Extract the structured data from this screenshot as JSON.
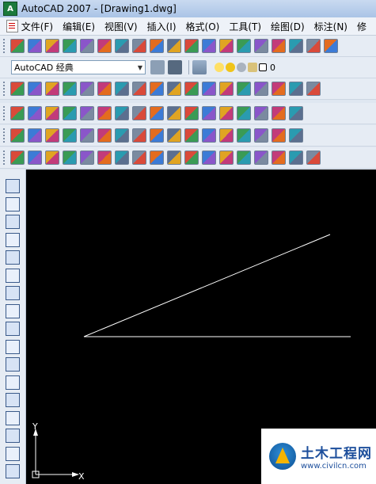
{
  "window": {
    "title": "AutoCAD 2007 - [Drawing1.dwg]",
    "app_icon_label": "A"
  },
  "menu": {
    "items": [
      "文件(F)",
      "编辑(E)",
      "视图(V)",
      "插入(I)",
      "格式(O)",
      "工具(T)",
      "绘图(D)",
      "标注(N)",
      "修"
    ]
  },
  "workspace": {
    "selected": "AutoCAD 经典"
  },
  "layer": {
    "current": "0"
  },
  "canvas": {
    "background": "#000000",
    "line_color": "#ffffff",
    "ucs_y_label": "Y",
    "ucs_x_label": "X"
  },
  "watermark": {
    "name": "土木工程网",
    "url": "www.civilcn.com"
  },
  "toolbars": {
    "row1_icons": [
      "new-icon",
      "open-icon",
      "save-icon",
      "print-icon",
      "preview-icon",
      "publish-icon",
      "plot-icon",
      "cut-icon",
      "copy-icon",
      "paste-icon",
      "match-prop-icon",
      "block-editor-icon",
      "undo-icon",
      "redo-icon",
      "pan-icon",
      "zoom-realtime-icon",
      "zoom-window-icon",
      "zoom-previous-icon",
      "properties-icon"
    ],
    "row3_icons": [
      "build-icon",
      "hidden-icon",
      "stair-icon",
      "hatch-icon",
      "grid-icon",
      "library-icon",
      "fixture-icon",
      "door-icon",
      "wall-icon",
      "circle-tool-icon",
      "spring-icon",
      "bolt-icon",
      "beam-icon",
      "tap-icon",
      "valve-icon",
      "tee-icon",
      "channel-icon",
      "pipe-icon"
    ],
    "row4_icons": [
      "table-icon",
      "find-icon",
      "erase-icon",
      "list-icon",
      "a2-icon",
      "search-icon",
      "component-icon",
      "cube-icon",
      "explode-icon",
      "join-icon",
      "mirror-icon",
      "curve-icon",
      "lock-icon",
      "swap-icon",
      "rotate-icon",
      "number-icon",
      "settings-icon"
    ],
    "row5_icons": [
      "text-icon",
      "angle-icon",
      "offset-icon",
      "snap-icon",
      "grip-icon",
      "align-icon",
      "distribute-icon",
      "stretch-icon",
      "measure-icon",
      "link-icon",
      "chain-icon",
      "scale-icon",
      "cross-icon",
      "trim-icon",
      "extend-icon",
      "fillet-icon",
      "chamfer-icon"
    ],
    "row6_icons": [
      "dim-linear-icon",
      "dim-weld-icon",
      "dim-eh-icon",
      "dim-ee-icon",
      "dim-fx-icon",
      "dim-000-icon",
      "dim-center-icon",
      "dim-scale-icon",
      "dim-31-icon",
      "dim-15-icon",
      "dim-15b-icon",
      "dim-15c-icon",
      "dim-21-icon",
      "dim-57-icon",
      "dim-arrow-icon",
      "dim-grid-icon",
      "dim-hatch-icon",
      "dim-rebar-icon"
    ]
  },
  "left_toolbar": {
    "icons": [
      "line-icon",
      "construction-line-icon",
      "polyline-icon",
      "polygon-icon",
      "rectangle-icon",
      "arc-icon",
      "circle-icon",
      "revcloud-icon",
      "spline-icon",
      "ellipse-icon",
      "ellipse-arc-icon",
      "insert-block-icon",
      "make-block-icon",
      "point-icon",
      "hatch-icon",
      "gradient-icon",
      "region-icon"
    ]
  }
}
